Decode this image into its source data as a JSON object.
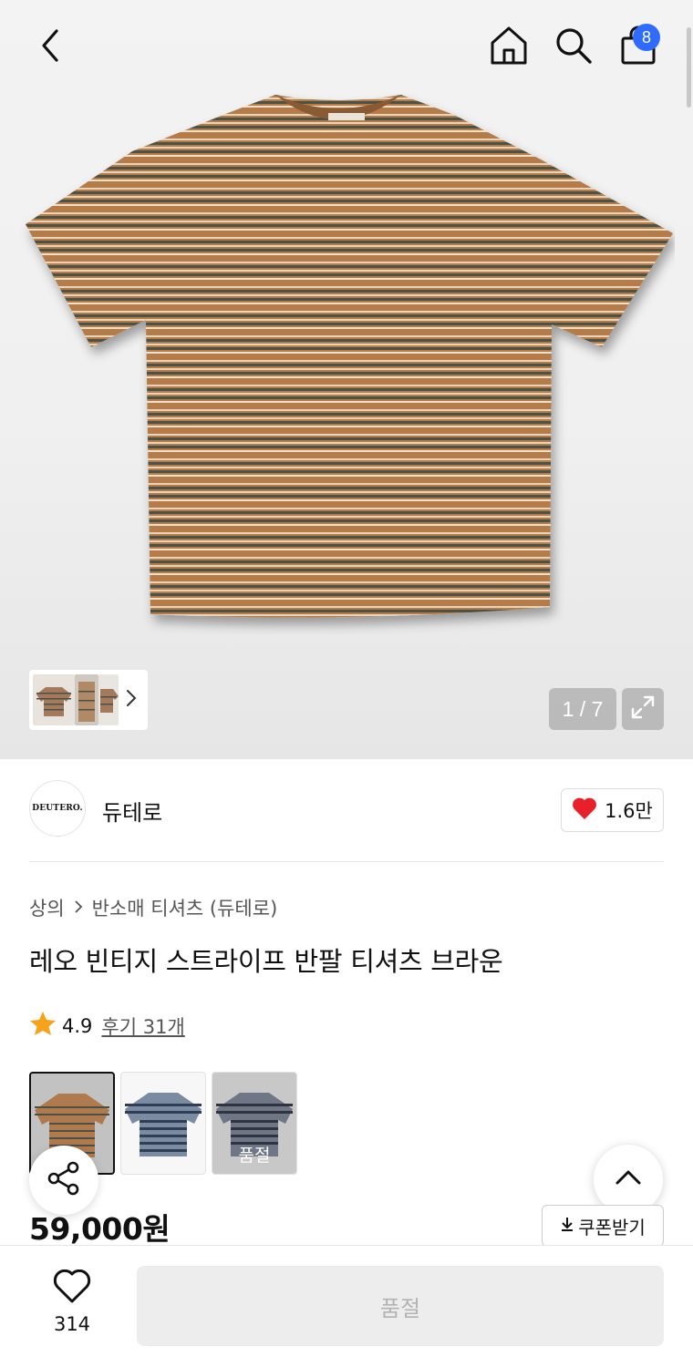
{
  "header": {
    "cart_count": "8"
  },
  "gallery": {
    "counter": "1 / 7"
  },
  "brand": {
    "name": "듀테로",
    "logo_text": "DEUTERO.",
    "likes": "1.6만"
  },
  "breadcrumb": {
    "category": "상의",
    "subcategory": "반소매 티셔츠 (듀테로)"
  },
  "product": {
    "title": "레오 빈티지 스트라이프 반팔 티셔츠 브라운",
    "rating": "4.9",
    "reviews": "후기 31개",
    "price": "59,000원"
  },
  "colors": [
    {
      "name": "brown",
      "swatch": "#b07a4f",
      "stripe": "#4d4f45",
      "selected": true
    },
    {
      "name": "navy",
      "swatch": "#6d7e95",
      "stripe": "#2f3d55",
      "selected": false
    },
    {
      "name": "charcoal",
      "swatch": "#6f7786",
      "stripe": "#2e3440",
      "selected": false,
      "soldout_label": "품절"
    }
  ],
  "coupon": {
    "label": "쿠폰받기"
  },
  "bottom_bar": {
    "wish_count": "314",
    "buy_label": "품절"
  },
  "icons": {
    "back": "chevron-left-icon",
    "home": "home-icon",
    "search": "search-icon",
    "bag": "shopping-bag-icon",
    "expand": "expand-icon",
    "heart": "heart-icon",
    "star": "star-icon",
    "share": "share-icon",
    "top": "chevron-up-icon",
    "download": "download-icon"
  },
  "accent_colors": {
    "badge": "#2f6bff",
    "heart": "#e8202a",
    "star": "#f7a21b"
  }
}
